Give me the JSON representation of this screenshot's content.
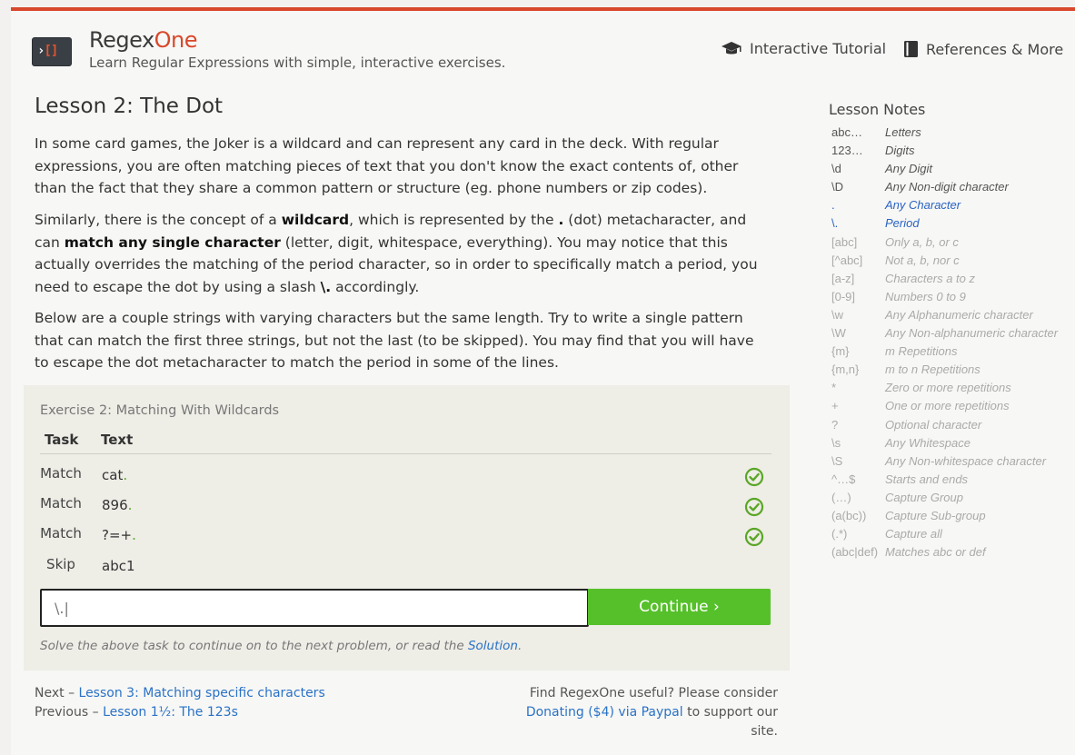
{
  "header": {
    "brand_main": "Regex",
    "brand_accent": "One",
    "tagline": "Learn Regular Expressions with simple, interactive exercises.",
    "nav": [
      {
        "label": "Interactive Tutorial",
        "icon": "graduation-cap-icon"
      },
      {
        "label": "References & More",
        "icon": "book-icon"
      }
    ],
    "logo_glyph_left": "›",
    "logo_glyph_right": "[]"
  },
  "lesson": {
    "title": "Lesson 2: The Dot",
    "p1": "In some card games, the Joker is a wildcard and can represent any card in the deck. With regular expressions, you are often matching pieces of text that you don't know the exact contents of, other than the fact that they share a common pattern or structure (eg. phone numbers or zip codes).",
    "p2_a": "Similarly, there is the concept of a ",
    "p2_b": "wildcard",
    "p2_c": ", which is represented by the ",
    "p2_d": ".",
    "p2_e": " (dot) metacharacter, and can ",
    "p2_f": "match any single character",
    "p2_g": " (letter, digit, whitespace, everything). You may notice that this actually overrides the matching of the period character, so in order to specifically match a period, you need to escape the dot by using a slash ",
    "p2_h": "\\.",
    "p2_i": " accordingly.",
    "p3": "Below are a couple strings with varying characters but the same length. Try to write a single pattern that can match the first three strings, but not the last (to be skipped). You may find that you will have to escape the dot metacharacter to match the period in some of the lines."
  },
  "exercise": {
    "title": "Exercise 2: Matching With Wildcards",
    "col_task": "Task",
    "col_text": "Text",
    "rows": [
      {
        "task": "Match",
        "text": "cat",
        "dot": ".",
        "status": "check-circle-icon"
      },
      {
        "task": "Match",
        "text": "896",
        "dot": ".",
        "status": "check-circle-icon"
      },
      {
        "task": "Match",
        "text": "?=+",
        "dot": ".",
        "status": "check-circle-icon"
      },
      {
        "task": "Skip",
        "text": "abc1",
        "dot": "",
        "status": ""
      }
    ],
    "input_value": "\\.|",
    "continue_label": "Continue ›",
    "hint_prefix": "Solve the above task to continue on to the next problem, or read the ",
    "hint_link": "Solution",
    "hint_suffix": ".",
    "check_color": "#5aa626"
  },
  "footer": {
    "next_prefix": "Next – ",
    "next_link": "Lesson 3: Matching specific characters",
    "prev_prefix": "Previous – ",
    "prev_link": "Lesson 1½: The 123s",
    "support_line1": "Find RegexOne useful? Please consider",
    "support_link": "Donating ($4) via Paypal",
    "support_suffix": " to support our site."
  },
  "notes": {
    "title": "Lesson Notes",
    "items": [
      {
        "key": "abc…",
        "value": "Letters",
        "state": "seen"
      },
      {
        "key": "123…",
        "value": "Digits",
        "state": "seen"
      },
      {
        "key": "\\d",
        "value": "Any Digit",
        "state": "seen"
      },
      {
        "key": "\\D",
        "value": "Any Non-digit character",
        "state": "seen"
      },
      {
        "key": ".",
        "value": "Any Character",
        "state": "current"
      },
      {
        "key": "\\.",
        "value": "Period",
        "state": "current"
      },
      {
        "key": "[abc]",
        "value": "Only a, b, or c",
        "state": "future"
      },
      {
        "key": "[^abc]",
        "value": "Not a, b, nor c",
        "state": "future"
      },
      {
        "key": "[a-z]",
        "value": "Characters a to z",
        "state": "future"
      },
      {
        "key": "[0-9]",
        "value": "Numbers 0 to 9",
        "state": "future"
      },
      {
        "key": "\\w",
        "value": "Any Alphanumeric character",
        "state": "future"
      },
      {
        "key": "\\W",
        "value": "Any Non-alphanumeric character",
        "state": "future"
      },
      {
        "key": "{m}",
        "value": "m Repetitions",
        "state": "future"
      },
      {
        "key": "{m,n}",
        "value": "m to n Repetitions",
        "state": "future"
      },
      {
        "key": "*",
        "value": "Zero or more repetitions",
        "state": "future"
      },
      {
        "key": "+",
        "value": "One or more repetitions",
        "state": "future"
      },
      {
        "key": "?",
        "value": "Optional character",
        "state": "future"
      },
      {
        "key": "\\s",
        "value": "Any Whitespace",
        "state": "future"
      },
      {
        "key": "\\S",
        "value": "Any Non-whitespace character",
        "state": "future"
      },
      {
        "key": "^…$",
        "value": "Starts and ends",
        "state": "future"
      },
      {
        "key": "(…)",
        "value": "Capture Group",
        "state": "future"
      },
      {
        "key": "(a(bc))",
        "value": "Capture Sub-group",
        "state": "future"
      },
      {
        "key": "(.*)",
        "value": "Capture all",
        "state": "future"
      },
      {
        "key": "(abc|def)",
        "value": "Matches abc or def",
        "state": "future"
      }
    ]
  }
}
